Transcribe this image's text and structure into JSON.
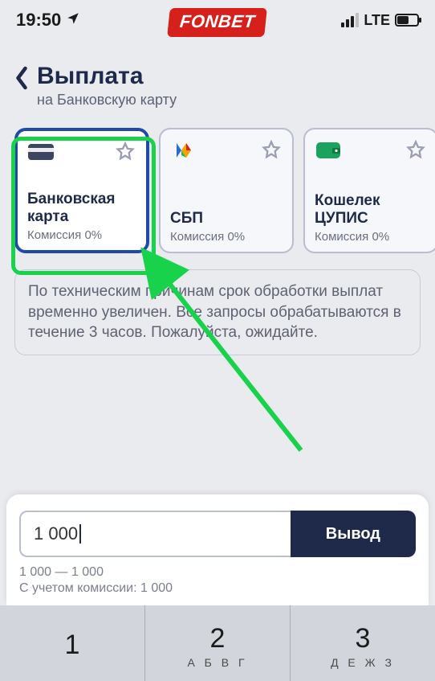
{
  "status": {
    "time": "19:50",
    "network": "LTE"
  },
  "brand": "FONBET",
  "header": {
    "title": "Выплата",
    "subtitle": "на Банковскую карту"
  },
  "methods": [
    {
      "id": "bank-card",
      "name": "Банковская карта",
      "fee": "Комиссия 0%",
      "icon": "card-icon",
      "selected": true
    },
    {
      "id": "sbp",
      "name": "СБП",
      "fee": "Комиссия 0%",
      "icon": "sbp-icon",
      "selected": false
    },
    {
      "id": "wallet",
      "name": "Кошелек ЦУПИС",
      "fee": "Комиссия 0%",
      "icon": "wallet-icon",
      "selected": false
    }
  ],
  "notice": "По техническим причинам срок обработки выплат временно увеличен. Все запросы обрабатываются в течение 3 часов. Пожалуйста, ожидайте.",
  "amount": {
    "value": "1 000",
    "limits": "1 000 — 1 000",
    "fee_note": "С учетом комиссии: 1 000",
    "button": "Вывод"
  },
  "keyboard": [
    {
      "digit": "1",
      "letters": ""
    },
    {
      "digit": "2",
      "letters": "А Б В Г"
    },
    {
      "digit": "3",
      "letters": "Д Е Ж З"
    }
  ]
}
